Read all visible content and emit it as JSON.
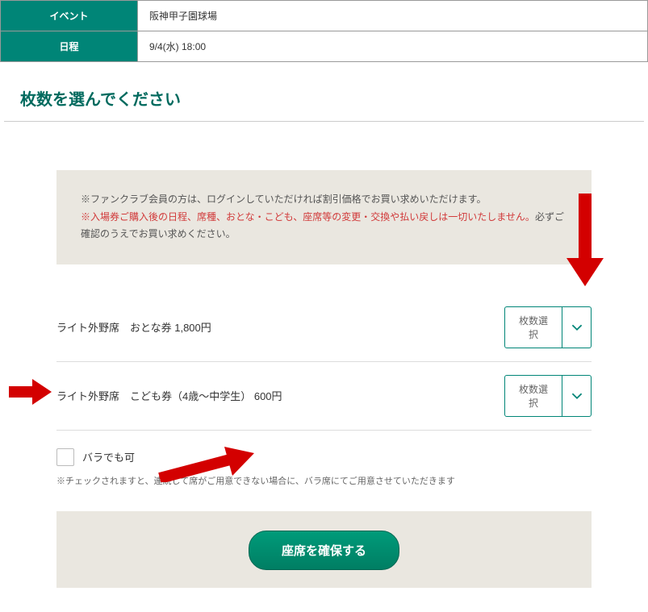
{
  "info": {
    "event_label": "イベント",
    "event_value": "阪神甲子園球場",
    "date_label": "日程",
    "date_value": "9/4(水) 18:00"
  },
  "heading": "枚数を選んでください",
  "notice": {
    "line1": "※ファンクラブ会員の方は、ログインしていただければ割引価格でお買い求めいただけます。",
    "line2_red": "※入場券ご購入後の日程、席種、おとな・こども、座席等の変更・交換や払い戻しは一切いたしません。",
    "line2_tail": "必ずご確認のうえでお買い求めください。"
  },
  "tickets": [
    {
      "label": "ライト外野席　おとな券 1,800円",
      "select_text": "枚数選択"
    },
    {
      "label": "ライト外野席　こども券（4歳～中学生） 600円",
      "select_text": "枚数選択"
    }
  ],
  "bara": {
    "label": "バラでも可",
    "note": "※チェックされますと、連続して席がご用意できない場合に、バラ席にてご用意させていただきます"
  },
  "submit_label": "座席を確保する"
}
